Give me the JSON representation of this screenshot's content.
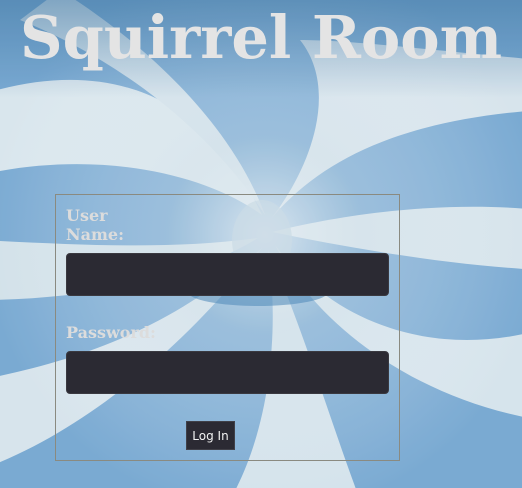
{
  "page": {
    "title": "Squirrel Room"
  },
  "login_form": {
    "username_label": "User Name:",
    "username_value": "",
    "password_label": "Password:",
    "password_value": "",
    "submit_label": "Log In"
  },
  "colors": {
    "title_text": "#e4e4e4",
    "input_background": "#2b2a33",
    "form_border": "#8a8a80",
    "background_blue": "#6fa3cf",
    "background_light": "#d9e6ee"
  },
  "background_image": "blue-white-swirl-pattern"
}
